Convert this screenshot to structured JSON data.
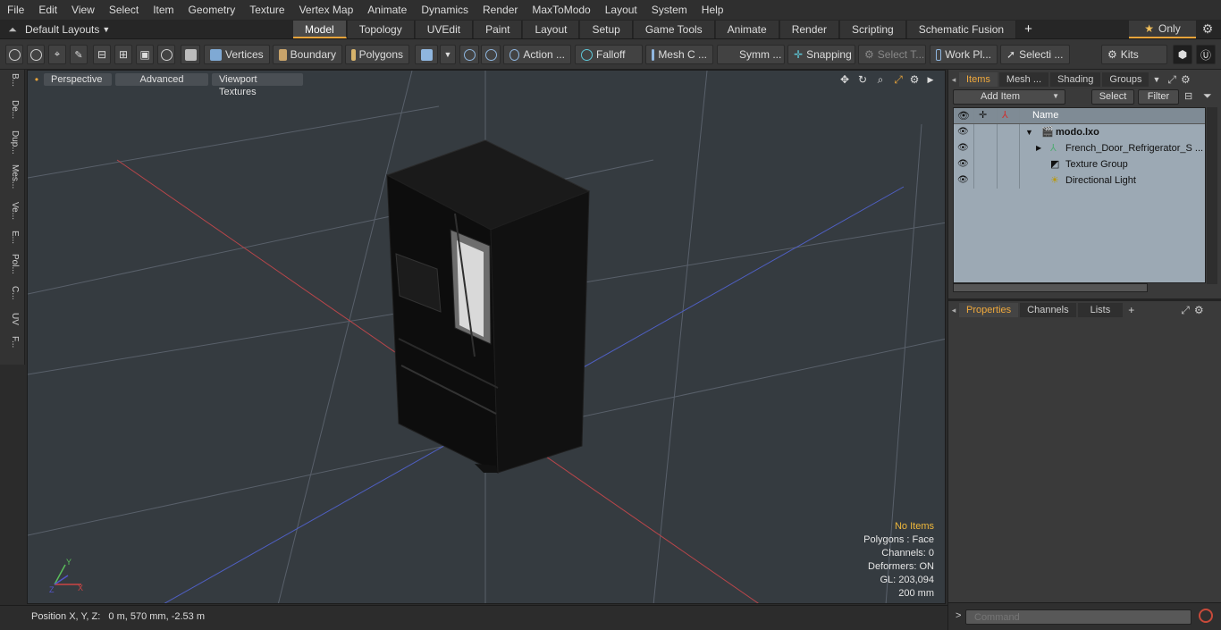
{
  "menu": [
    "File",
    "Edit",
    "View",
    "Select",
    "Item",
    "Geometry",
    "Texture",
    "Vertex Map",
    "Animate",
    "Dynamics",
    "Render",
    "MaxToModo",
    "Layout",
    "System",
    "Help"
  ],
  "layout_selector": {
    "label": "Default Layouts"
  },
  "tabs": [
    {
      "label": "Model",
      "active": true
    },
    {
      "label": "Topology"
    },
    {
      "label": "UVEdit"
    },
    {
      "label": "Paint"
    },
    {
      "label": "Layout"
    },
    {
      "label": "Setup"
    },
    {
      "label": "Game Tools"
    },
    {
      "label": "Animate"
    },
    {
      "label": "Render"
    },
    {
      "label": "Scripting"
    },
    {
      "label": "Schematic Fusion"
    }
  ],
  "only_button": {
    "label": "Only"
  },
  "toolbar": {
    "vertices": "Vertices",
    "boundary": "Boundary",
    "polygons": "Polygons",
    "action": "Action ...",
    "falloff": "Falloff",
    "mesh_c": "Mesh C ...",
    "symm": "Symm ...",
    "snapping": "Snapping",
    "select_t": "Select T...",
    "work_pl": "Work Pl...",
    "selecti": "Selecti ...",
    "kits": "Kits"
  },
  "left_tabs": [
    "B...",
    "De...",
    "Dup...",
    "Mes...",
    "Ve...",
    "E...",
    "Pol...",
    "C...",
    "UV",
    "F..."
  ],
  "viewport": {
    "view_mode": "Perspective",
    "shading": "Advanced",
    "textures": "Viewport Textures",
    "info": {
      "selection": "No Items",
      "polygons": "Polygons : Face",
      "channels": "Channels: 0",
      "deformers": "Deformers: ON",
      "gl": "GL: 203,094",
      "grid": "200 mm"
    },
    "axis": {
      "y": "Y",
      "x": "X",
      "z": "Z"
    }
  },
  "status": {
    "position": "Position X, Y, Z:   0 m, 570 mm, -2.53 m"
  },
  "items_panel": {
    "tabs": [
      {
        "label": "Items",
        "active": true
      },
      {
        "label": "Mesh ..."
      },
      {
        "label": "Shading"
      },
      {
        "label": "Groups"
      }
    ],
    "add_item": "Add Item",
    "select": "Select",
    "filter": "Filter",
    "column_name": "Name",
    "rows": [
      {
        "name": "modo.lxo"
      },
      {
        "name": "French_Door_Refrigerator_S ..."
      },
      {
        "name": "Texture Group"
      },
      {
        "name": "Directional Light"
      }
    ]
  },
  "properties_panel": {
    "tabs": [
      {
        "label": "Properties",
        "active": true
      },
      {
        "label": "Channels"
      },
      {
        "label": "Lists"
      }
    ],
    "plus": "+"
  },
  "command": {
    "placeholder": "Command",
    "prompt": ">"
  },
  "colors": {
    "accent": "#e7a33a",
    "viewport_bg": "#353b40",
    "list_bg": "#9ca9b4",
    "warn": "#f0b83b"
  }
}
